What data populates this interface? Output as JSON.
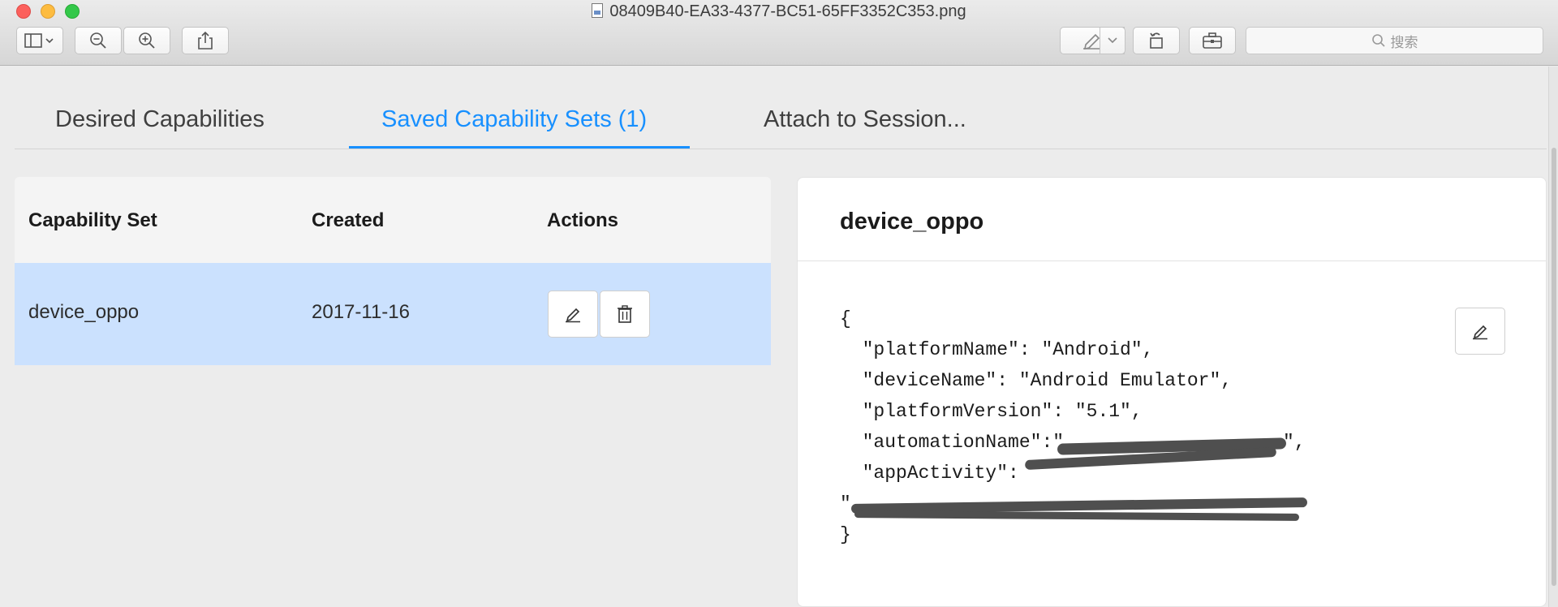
{
  "window": {
    "title": "08409B40-EA33-4377-BC51-65FF3352C353.png"
  },
  "toolbar": {
    "search_placeholder": "搜索"
  },
  "tabs": [
    {
      "label": "Desired Capabilities"
    },
    {
      "label": "Saved Capability Sets (1)"
    },
    {
      "label": "Attach to Session..."
    }
  ],
  "table": {
    "headers": [
      "Capability Set",
      "Created",
      "Actions"
    ],
    "rows": [
      {
        "name": "device_oppo",
        "created": "2017-11-16"
      }
    ]
  },
  "detail": {
    "title": "device_oppo",
    "json_lines": [
      "{",
      "  \"platformName\": \"Android\",",
      "  \"deviceName\": \"Android Emulator\",",
      "  \"platformVersion\": \"5.1\",",
      "  \"automationName\":\"",
      "  \"appActivity\":",
      "\"",
      "}"
    ],
    "redacted_suffix": "\","
  },
  "colors": {
    "accent": "#1890ff",
    "selected_row": "#cbe1fe"
  }
}
